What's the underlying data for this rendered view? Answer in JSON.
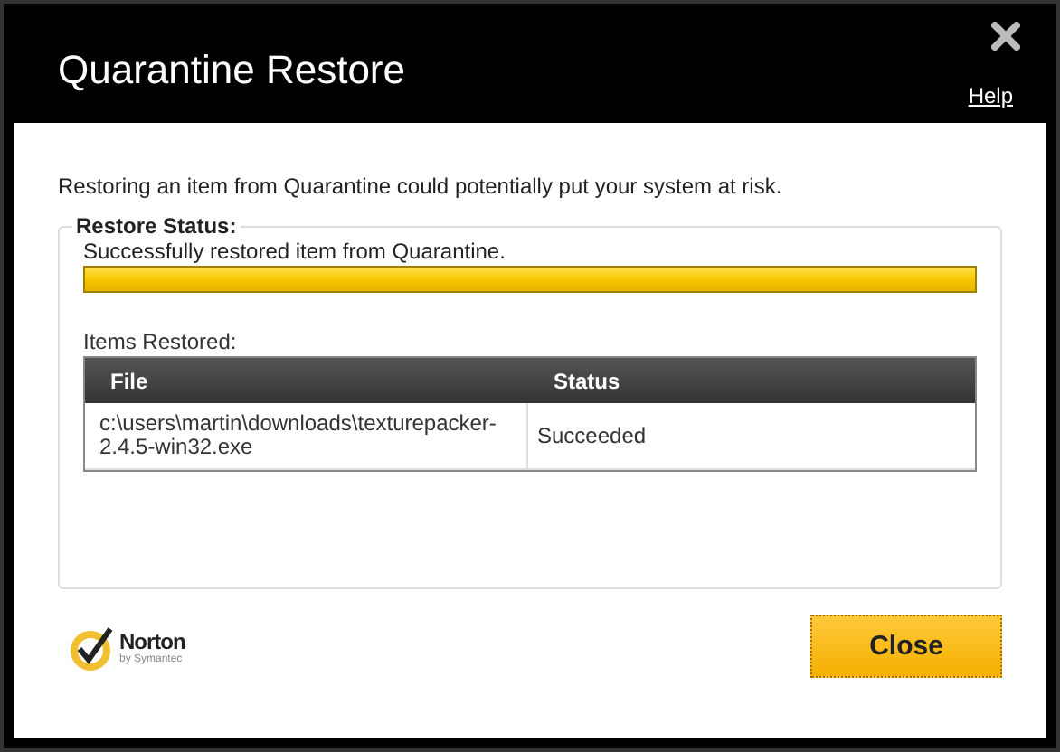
{
  "window": {
    "title": "Quarantine Restore",
    "help_link": "Help"
  },
  "warning": "Restoring an item from Quarantine could potentially put your system at risk.",
  "restore_status": {
    "legend": "Restore Status:",
    "message": "Successfully restored item from Quarantine.",
    "level": 1
  },
  "items_restored": {
    "label": "Items Restored:",
    "columns": [
      "File",
      "Status"
    ],
    "rows": [
      {
        "file": "c:\\users\\martin\\downloads\\texturepacker-2.4.5-win32.exe",
        "status": "Succeeded"
      }
    ]
  },
  "logo": {
    "name": "Norton",
    "tagline": "by Symantec"
  },
  "buttons": [
    "Close"
  ]
}
